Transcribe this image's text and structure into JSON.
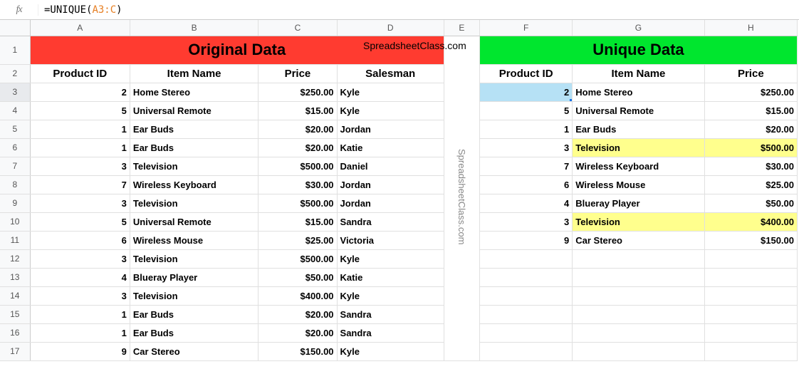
{
  "formula_bar": {
    "fx_label": "fx",
    "prefix": "=UNIQUE(",
    "ref": "A3:C",
    "suffix": ")"
  },
  "columns": {
    "A": "A",
    "B": "B",
    "C": "C",
    "D": "D",
    "E": "E",
    "F": "F",
    "G": "G",
    "H": "H"
  },
  "row_numbers": [
    "1",
    "2",
    "3",
    "4",
    "5",
    "6",
    "7",
    "8",
    "9",
    "10",
    "11",
    "12",
    "13",
    "14",
    "15",
    "16",
    "17"
  ],
  "titles": {
    "original": "Original Data",
    "unique": "Unique Data"
  },
  "headers": {
    "product_id": "Product ID",
    "item_name": "Item Name",
    "price": "Price",
    "salesman": "Salesman"
  },
  "original_rows": [
    {
      "id": "2",
      "name": "Home Stereo",
      "price": "$250.00",
      "sales": "Kyle"
    },
    {
      "id": "5",
      "name": "Universal Remote",
      "price": "$15.00",
      "sales": "Kyle"
    },
    {
      "id": "1",
      "name": "Ear Buds",
      "price": "$20.00",
      "sales": "Jordan"
    },
    {
      "id": "1",
      "name": "Ear Buds",
      "price": "$20.00",
      "sales": "Katie"
    },
    {
      "id": "3",
      "name": "Television",
      "price": "$500.00",
      "sales": "Daniel"
    },
    {
      "id": "7",
      "name": "Wireless Keyboard",
      "price": "$30.00",
      "sales": "Jordan"
    },
    {
      "id": "3",
      "name": "Television",
      "price": "$500.00",
      "sales": "Jordan"
    },
    {
      "id": "5",
      "name": "Universal Remote",
      "price": "$15.00",
      "sales": "Sandra"
    },
    {
      "id": "6",
      "name": "Wireless Mouse",
      "price": "$25.00",
      "sales": "Victoria"
    },
    {
      "id": "3",
      "name": "Television",
      "price": "$500.00",
      "sales": "Kyle"
    },
    {
      "id": "4",
      "name": "Blueray Player",
      "price": "$50.00",
      "sales": "Katie"
    },
    {
      "id": "3",
      "name": "Television",
      "price": "$400.00",
      "sales": "Kyle"
    },
    {
      "id": "1",
      "name": "Ear Buds",
      "price": "$20.00",
      "sales": "Sandra"
    },
    {
      "id": "1",
      "name": "Ear Buds",
      "price": "$20.00",
      "sales": "Sandra"
    },
    {
      "id": "9",
      "name": "Car Stereo",
      "price": "$150.00",
      "sales": "Kyle"
    }
  ],
  "unique_rows": [
    {
      "id": "2",
      "name": "Home Stereo",
      "price": "$250.00",
      "hl": false
    },
    {
      "id": "5",
      "name": "Universal Remote",
      "price": "$15.00",
      "hl": false
    },
    {
      "id": "1",
      "name": "Ear Buds",
      "price": "$20.00",
      "hl": false
    },
    {
      "id": "3",
      "name": "Television",
      "price": "$500.00",
      "hl": true
    },
    {
      "id": "7",
      "name": "Wireless Keyboard",
      "price": "$30.00",
      "hl": false
    },
    {
      "id": "6",
      "name": "Wireless Mouse",
      "price": "$25.00",
      "hl": false
    },
    {
      "id": "4",
      "name": "Blueray Player",
      "price": "$50.00",
      "hl": false
    },
    {
      "id": "3",
      "name": "Television",
      "price": "$400.00",
      "hl": true
    },
    {
      "id": "9",
      "name": "Car Stereo",
      "price": "$150.00",
      "hl": false
    }
  ],
  "watermark": "SpreadsheetClass.com",
  "col_widths": {
    "A": 140,
    "B": 180,
    "C": 110,
    "D": 150,
    "E": 50,
    "F": 130,
    "G": 185,
    "H": 130
  },
  "selected_cell": "F3",
  "highlight_color": "#ffff8d"
}
